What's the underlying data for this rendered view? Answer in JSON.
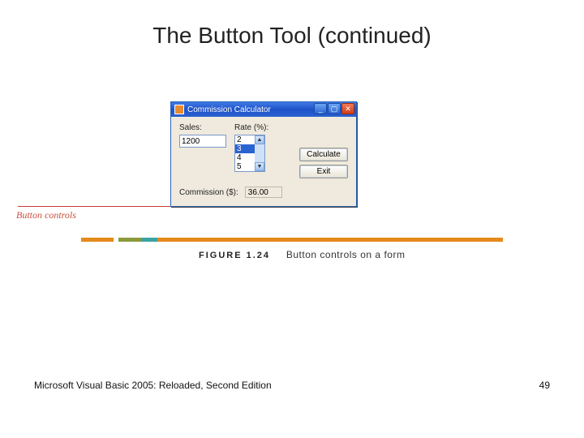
{
  "slide_title": "The Button Tool (continued)",
  "window": {
    "title": "Commission Calculator",
    "labels": {
      "sales": "Sales:",
      "rate": "Rate (%):",
      "commission": "Commission ($):"
    },
    "sales_value": "1200",
    "rate_options": [
      "2",
      "3",
      "4",
      "5"
    ],
    "rate_selected_index": 1,
    "commission_value": "36.00",
    "buttons": {
      "calculate": "Calculate",
      "exit": "Exit"
    }
  },
  "callout": "Button controls",
  "figure": {
    "number": "FIGURE 1.24",
    "caption": "Button controls on a form"
  },
  "footer": {
    "left": "Microsoft Visual Basic 2005: Reloaded, Second Edition",
    "right": "49"
  }
}
